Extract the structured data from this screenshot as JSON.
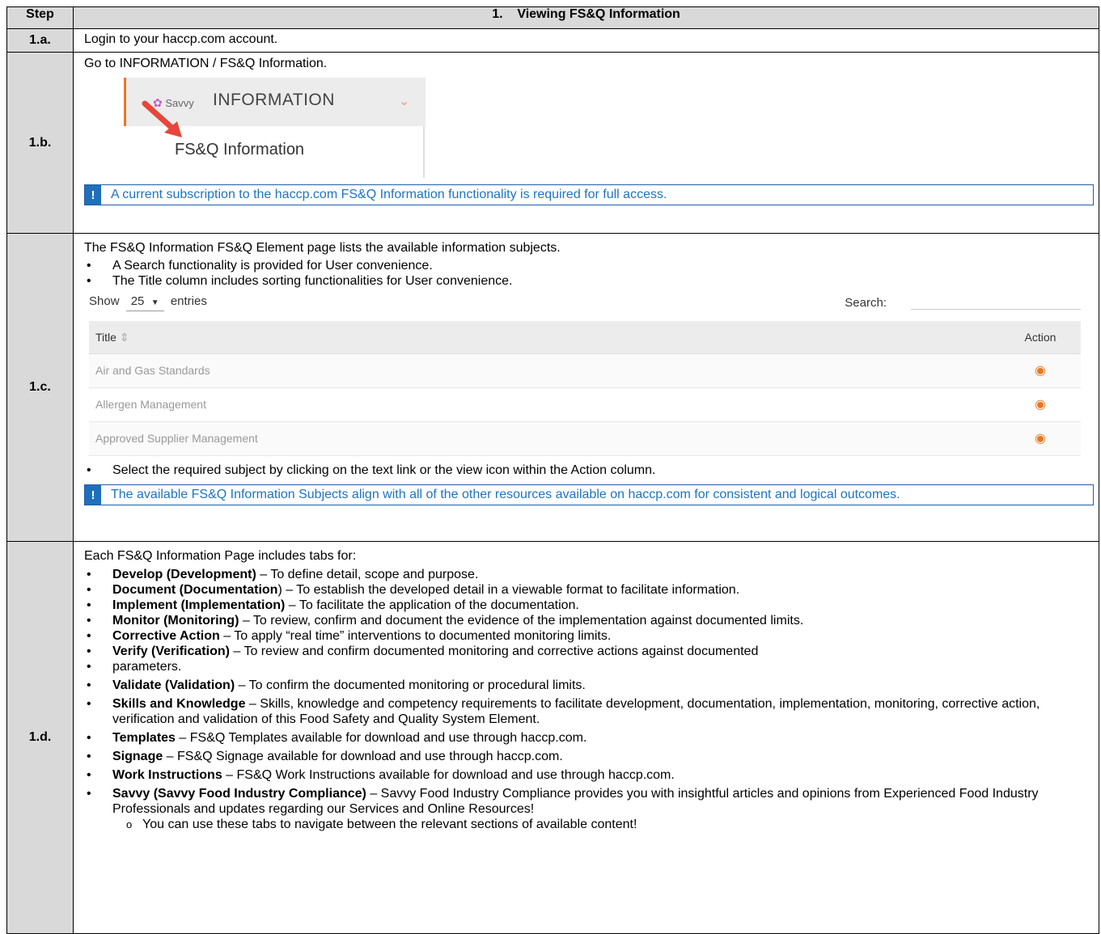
{
  "header": {
    "step": "Step",
    "title": "1.    Viewing FS&Q Information"
  },
  "rows": {
    "r1a": {
      "step": "1.a.",
      "text": "Login to your haccp.com account."
    },
    "r1b": {
      "step": "1.b.",
      "text": "Go to INFORMATION / FS&Q Information.",
      "menu": {
        "brand": "Savvy",
        "menu_label": "INFORMATION",
        "submenu_label": "FS&Q Information"
      },
      "note": "A current subscription to the haccp.com FS&Q Information functionality is required for full access."
    },
    "r1c": {
      "step": "1.c.",
      "intro": "The FS&Q Information FS&Q Element page lists the available information subjects.",
      "bullets": [
        "A Search functionality is provided for User convenience.",
        "The Title column includes sorting functionalities for User convenience."
      ],
      "table": {
        "show_label": "Show",
        "show_value": "25",
        "entries_label": "entries",
        "search_label": "Search:",
        "col_title": "Title",
        "col_action": "Action",
        "rows": [
          "Air and Gas Standards",
          "Allergen Management",
          "Approved Supplier Management"
        ]
      },
      "after": "Select the required subject by clicking on the text link or the view icon within the Action column.",
      "note": "The available FS&Q Information Subjects align with all of the other resources available on haccp.com for consistent and logical outcomes."
    },
    "r1d": {
      "step": "1.d.",
      "intro": "Each FS&Q Information Page includes tabs for:",
      "items": [
        {
          "b": "Develop (Development)",
          "t": " – To define detail, scope and purpose."
        },
        {
          "b": "Document (Documentation",
          "t": ") – To establish the developed detail in a viewable format to facilitate information."
        },
        {
          "b": "Implement (Implementation)",
          "t": " – To facilitate the application of the documentation."
        },
        {
          "b": "Monitor (Monitoring)",
          "t": " – To review, confirm and document the evidence of the implementation against documented limits."
        },
        {
          "b": "Corrective Action",
          "t": " – To apply “real time” interventions to documented monitoring limits."
        },
        {
          "b": "Verify (Verification)",
          "t": " – To review and confirm documented monitoring and corrective actions against documented"
        },
        {
          "b": "",
          "t": "parameters."
        },
        {
          "b": "Validate (Validation)",
          "t": " – To confirm the documented monitoring or procedural limits."
        },
        {
          "b": "Skills and Knowledge",
          "t": " – Skills, knowledge and competency requirements to facilitate development, documentation, implementation, monitoring, corrective action, verification and validation of this Food Safety and Quality System Element."
        },
        {
          "b": "Templates",
          "t": " – FS&Q Templates available for download and use through haccp.com."
        },
        {
          "b": "Signage",
          "t": " – FS&Q Signage available for download and use through haccp.com."
        },
        {
          "b": "Work Instructions",
          "t": " – FS&Q Work Instructions available for download and use through haccp.com."
        },
        {
          "b": "Savvy (Savvy Food Industry Compliance)",
          "t": " – Savvy Food Industry Compliance provides you with insightful articles and opinions from Experienced Food Industry Professionals and updates regarding our Services and Online Resources!"
        }
      ],
      "sub": "You can use these tabs to navigate between the relevant sections of available content!"
    }
  },
  "icons": {
    "note": "exclamation-icon",
    "view": "eye-icon",
    "sort": "sort-icon",
    "dropdown": "caret-down-icon"
  }
}
